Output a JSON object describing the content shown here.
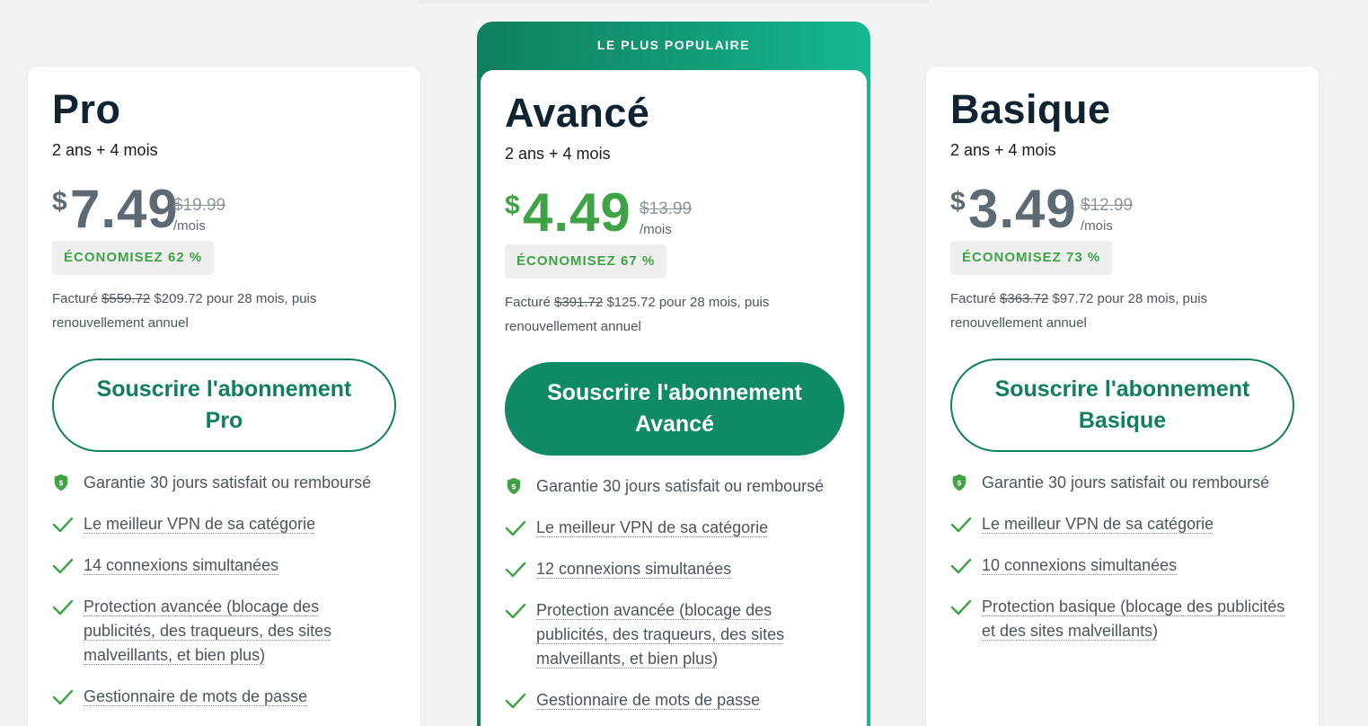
{
  "featured_label": "LE PLUS POPULAIRE",
  "plans": {
    "pro": {
      "name": "Pro",
      "term": "2 ans + 4 mois",
      "currency": "$",
      "price": "7.49",
      "old_price": "$19.99",
      "per": "/mois",
      "savings": "ÉCONOMISEZ 62 %",
      "billed_prefix": "Facturé",
      "billed_old": "$559.72",
      "billed_rest": "$209.72 pour 28 mois, puis renouvellement annuel",
      "cta": "Souscrire l'abonnement Pro",
      "guarantee": "Garantie 30 jours satisfait ou remboursé",
      "features": [
        "Le meilleur VPN de sa catégorie",
        "14 connexions simultanées",
        "Protection avancée (blocage des publicités, des traqueurs, des sites malveillants, et bien plus)",
        "Gestionnaire de mots de passe"
      ]
    },
    "advanced": {
      "name": "Avancé",
      "term": "2 ans + 4 mois",
      "currency": "$",
      "price": "4.49",
      "old_price": "$13.99",
      "per": "/mois",
      "savings": "ÉCONOMISEZ 67 %",
      "billed_prefix": "Facturé",
      "billed_old": "$391.72",
      "billed_rest": "$125.72 pour 28 mois, puis renouvellement annuel",
      "cta": "Souscrire l'abonnement Avancé",
      "guarantee": "Garantie 30 jours satisfait ou remboursé",
      "features": [
        "Le meilleur VPN de sa catégorie",
        "12 connexions simultanées",
        "Protection avancée (blocage des publicités, des traqueurs, des sites malveillants, et bien plus)",
        "Gestionnaire de mots de passe"
      ]
    },
    "basic": {
      "name": "Basique",
      "term": "2 ans + 4 mois",
      "currency": "$",
      "price": "3.49",
      "old_price": "$12.99",
      "per": "/mois",
      "savings": "ÉCONOMISEZ 73 %",
      "billed_prefix": "Facturé",
      "billed_old": "$363.72",
      "billed_rest": "$97.72 pour 28 mois, puis renouvellement annuel",
      "cta": "Souscrire l'abonnement Basique",
      "guarantee": "Garantie 30 jours satisfait ou remboursé",
      "features": [
        "Le meilleur VPN de sa catégorie",
        "10 connexions simultanées",
        "Protection basique (blocage des publicités et des sites malveillants)"
      ]
    }
  },
  "colors": {
    "brand_green": "#0f7f5e",
    "price_green": "#3da345",
    "check_green": "#3da345"
  },
  "icons": {
    "guarantee": "shield-dollar-icon",
    "feature": "check-icon"
  }
}
